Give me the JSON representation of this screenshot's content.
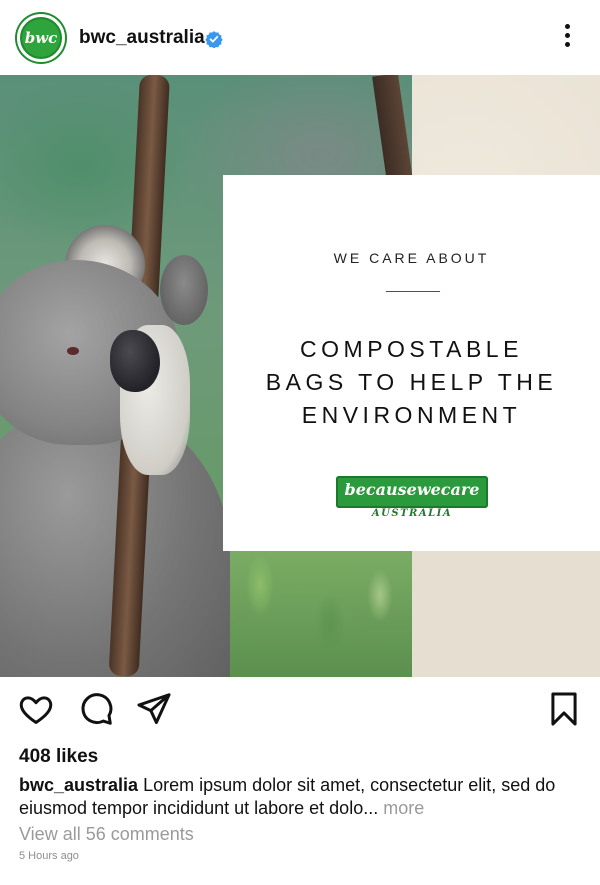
{
  "header": {
    "avatar_text": "bwc",
    "username": "bwc_australia",
    "verified_icon": "verified-badge-icon",
    "more_icon": "more-options-icon"
  },
  "post": {
    "card": {
      "eyebrow": "WE CARE ABOUT",
      "headline_lines": [
        "COMPOSTABLE",
        "BAGS TO HELP THE",
        "ENVIRONMENT"
      ],
      "logo_main": "becausewecare",
      "logo_sub": "AUSTRALIA"
    }
  },
  "actions": {
    "like_icon": "heart-icon",
    "comment_icon": "comment-icon",
    "share_icon": "send-icon",
    "save_icon": "bookmark-icon"
  },
  "likes": "408 likes",
  "caption": {
    "username": "bwc_australia",
    "text": "Lorem ipsum dolor sit amet, consectetur elit, sed do eiusmod tempor incididunt ut labore et dolo...",
    "more": "more"
  },
  "comments_link": "View all 56 comments",
  "timestamp": "5 Hours ago",
  "colors": {
    "brand_green": "#2a9a3c",
    "divider_green": "#1f6b4a",
    "verified_blue": "#3897f0",
    "muted_text": "#9a9a9a"
  }
}
